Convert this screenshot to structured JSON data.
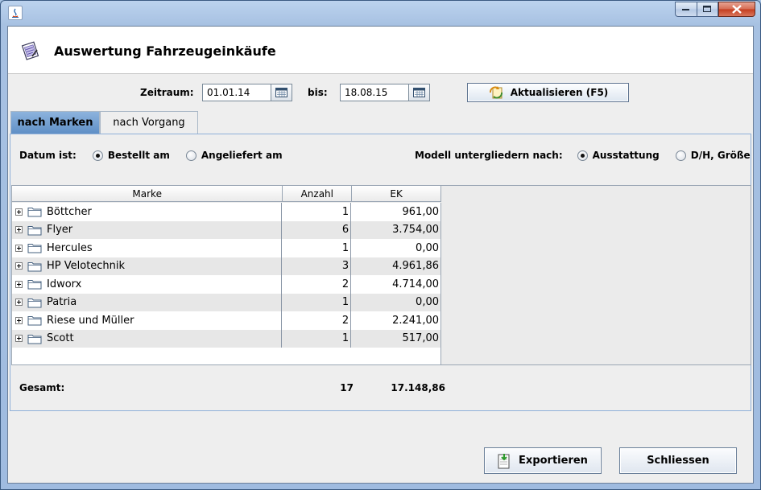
{
  "window": {
    "title": "",
    "buttons": {
      "minimize": "minimize",
      "maximize": "maximize",
      "close": "close"
    }
  },
  "header": {
    "title": "Auswertung Fahrzeugeinkäufe"
  },
  "filter": {
    "zeitraum_label": "Zeitraum:",
    "from_value": "01.01.14",
    "bis_label": "bis:",
    "to_value": "18.08.15",
    "refresh_label": "Aktualisieren (F5)"
  },
  "tabs": [
    {
      "label": "nach Marken",
      "active": true
    },
    {
      "label": "nach Vorgang",
      "active": false
    }
  ],
  "options": {
    "datum_label": "Datum ist:",
    "datum_choices": [
      {
        "label": "Bestellt am",
        "selected": true
      },
      {
        "label": "Angeliefert am",
        "selected": false
      }
    ],
    "modell_label": "Modell untergliedern nach:",
    "modell_choices": [
      {
        "label": "Ausstattung",
        "selected": true
      },
      {
        "label": "D/H, Größe",
        "selected": false
      }
    ]
  },
  "table": {
    "columns": [
      "Marke",
      "Anzahl",
      "EK"
    ],
    "rows": [
      {
        "marke": "Böttcher",
        "anzahl": "1",
        "ek": "961,00"
      },
      {
        "marke": "Flyer",
        "anzahl": "6",
        "ek": "3.754,00"
      },
      {
        "marke": "Hercules",
        "anzahl": "1",
        "ek": "0,00"
      },
      {
        "marke": "HP Velotechnik",
        "anzahl": "3",
        "ek": "4.961,86"
      },
      {
        "marke": "Idworx",
        "anzahl": "2",
        "ek": "4.714,00"
      },
      {
        "marke": "Patria",
        "anzahl": "1",
        "ek": "0,00"
      },
      {
        "marke": "Riese und Müller",
        "anzahl": "2",
        "ek": "2.241,00"
      },
      {
        "marke": "Scott",
        "anzahl": "1",
        "ek": "517,00"
      }
    ]
  },
  "totals": {
    "label": "Gesamt:",
    "anzahl": "17",
    "ek": "17.148,86"
  },
  "footer": {
    "export_label": "Exportieren",
    "close_label": "Schliessen"
  },
  "colors": {
    "tab_active": "#6f9bcf",
    "panel_border": "#8fb0d8",
    "frame": "#a9c4e4",
    "close_button": "#c94a2e"
  }
}
